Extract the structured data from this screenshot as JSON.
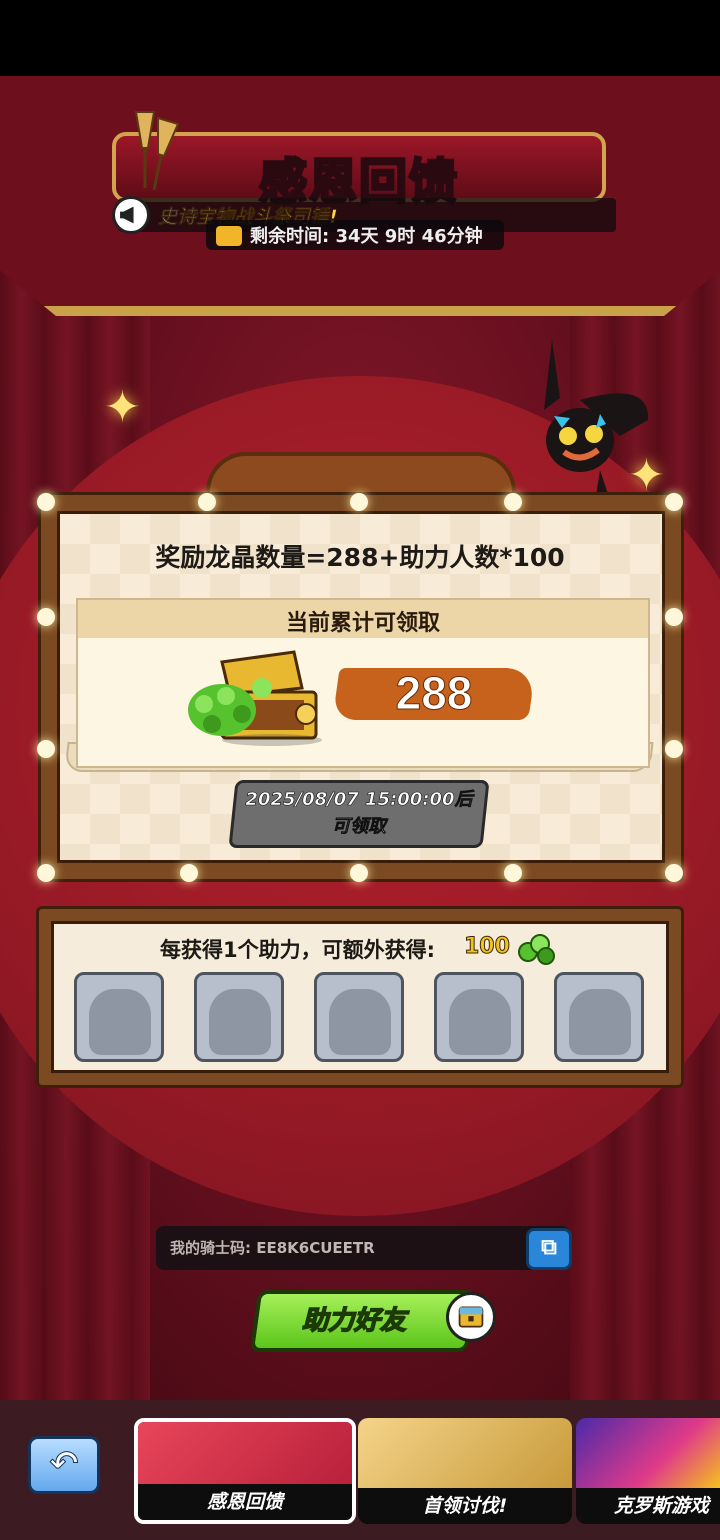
{
  "event": {
    "title": "感恩回馈",
    "notice_white": "史诗",
    "notice_gold": "宝物战斗祭司锤!",
    "timer": "剩余时间: 34天 9时 46分钟"
  },
  "reward": {
    "formula": "奖励龙晶数量=288+助力人数*100",
    "panel_header": "当前累计可领取",
    "amount": "288",
    "claim_time_line1": "2025/08/07 15:00:00后",
    "claim_time_line2": "可领取"
  },
  "helpers": {
    "label": "每获得1个助力，可额外获得:",
    "bonus": "100",
    "slots": [
      "",
      "",
      "",
      "",
      ""
    ]
  },
  "invite": {
    "code_text": "我的骑士码: EE8K6CUEETR",
    "copy_icon": "copy-icon",
    "help_button": "助力好友"
  },
  "tabs": [
    {
      "label": "感恩回馈",
      "active": true
    },
    {
      "label": "首领讨伐!",
      "active": false
    },
    {
      "label": "克罗斯游戏",
      "active": false
    }
  ],
  "colors": {
    "stage_red": "#8a1a2a",
    "gold": "#d2a44d",
    "amount_brush": "#c6621c",
    "help_green": "#5cc51a",
    "copy_blue": "#2a86d8"
  }
}
